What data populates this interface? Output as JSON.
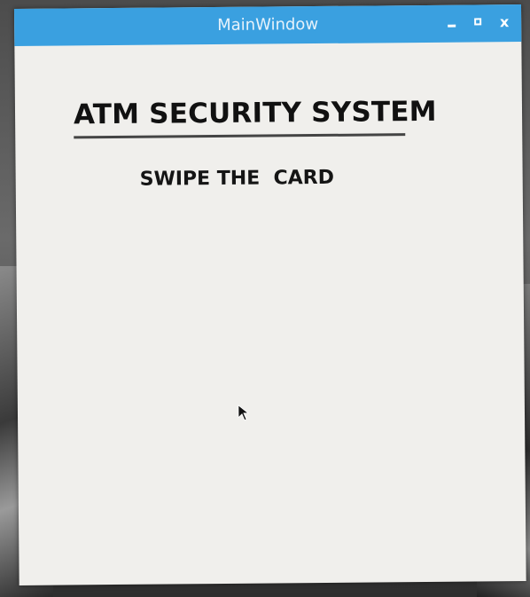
{
  "window": {
    "title": "MainWindow",
    "controls": {
      "minimize": "minimize-icon",
      "maximize": "maximize-icon",
      "close": "close-icon",
      "close_glyph": "x"
    }
  },
  "content": {
    "heading": "ATM SECURITY SYSTEM",
    "subheading": "SWIPE THE  CARD"
  },
  "colors": {
    "titlebar": "#3aa0e0",
    "window_bg": "#f0efec",
    "text": "#111111"
  }
}
